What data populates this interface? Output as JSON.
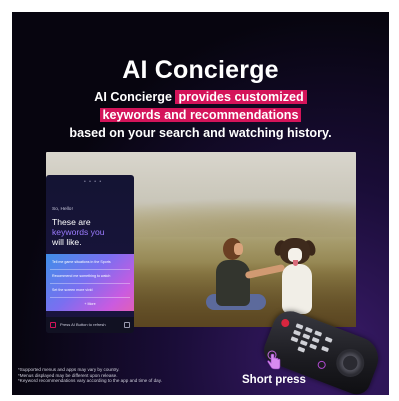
{
  "header": {
    "title": "AI Concierge",
    "subtitle_line1_pre": "AI Concierge ",
    "subtitle_line1_hl": "provides customized",
    "subtitle_line2_hl": "keywords and recommendations",
    "subtitle_line3": "based on your search and watching history."
  },
  "panel": {
    "pager": "• • • •",
    "greeting": "So, Hello!",
    "headline_1": "These are",
    "headline_2": "keywords you",
    "headline_3": "will like.",
    "cards": [
      "Tell me game situations in the Sports",
      "Recommend me something to watch",
      "Set the screen more vivid"
    ],
    "more_label": "+ More",
    "footer_text": "Press  AI Button  to refresh"
  },
  "callout": {
    "press_label": "Short press"
  },
  "footnotes": [
    "*Supported menus and apps may vary by country.",
    "*Menus displayed may be different upon release.",
    "*Keyword recommendations vary according to the app and time of day."
  ],
  "colors": {
    "highlight": "#d4145a",
    "accent_text": "#9b7bff"
  },
  "icons": [
    "tap-hand-icon",
    "power-icon",
    "ai-button-icon",
    "refresh-icon"
  ]
}
